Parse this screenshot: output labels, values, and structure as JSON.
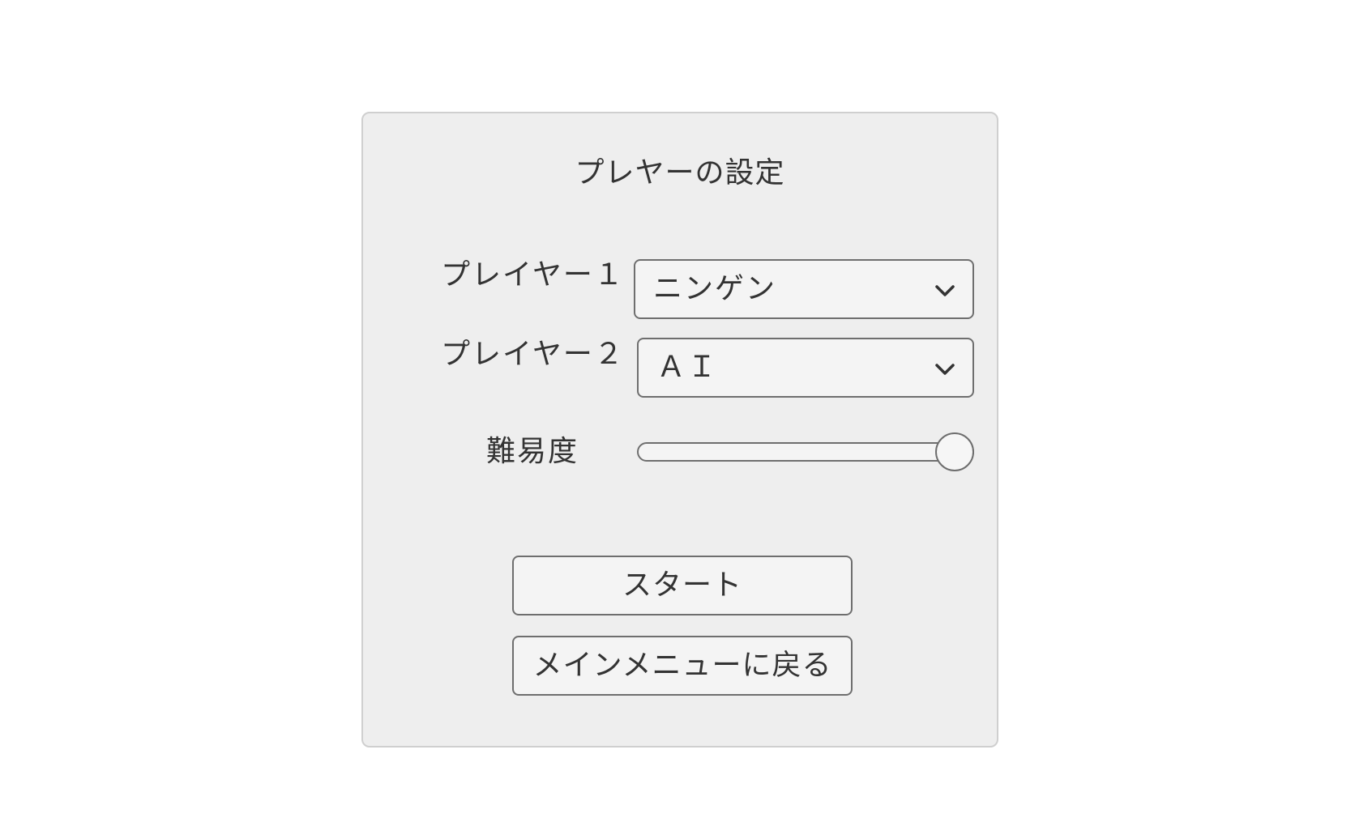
{
  "dialog": {
    "title": "プレヤーの設定"
  },
  "player1": {
    "label": "プレイヤー１",
    "selected": "ニンゲン"
  },
  "player2": {
    "label": "プレイヤー２",
    "selected": "ＡＩ"
  },
  "difficulty": {
    "label": "難易度",
    "value_fraction": 1.0
  },
  "buttons": {
    "start_label": "スタート",
    "back_label": "メインメニューに戻る"
  },
  "icons": {
    "dropdown": "chevron-down-icon"
  },
  "colors": {
    "panel_bg": "#eeeeee",
    "control_bg": "#f4f4f4",
    "border": "#6e6e6e",
    "text": "#333333"
  }
}
